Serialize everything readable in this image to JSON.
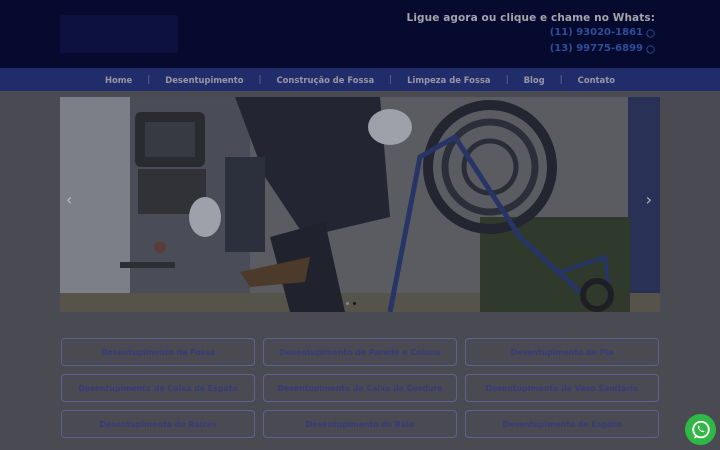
{
  "header": {
    "cta_text": "Ligue agora ou clique e chame no Whats:",
    "phones": [
      "(11) 93020-1861",
      "(13) 99775-6899"
    ],
    "phone_icon": "whatsapp-icon"
  },
  "nav": {
    "items": [
      "Home",
      "Desentupimento",
      "Construção de Fossa",
      "Limpeza de Fossa",
      "Blog",
      "Contato"
    ]
  },
  "hero": {
    "prev_glyph": "‹",
    "next_glyph": "›",
    "slide_count": 2,
    "active_slide": 2
  },
  "services": [
    "Desentupimento de Fossa",
    "Desentupimento de Parede e Coluna",
    "Desentupimento de Pia",
    "Desentupimento de Caixa de Esgoto",
    "Desentupimento de Caixa de Gordura",
    "Desentupimento de Vaso Sanitário",
    "Desentupimento de Raízes",
    "Desentupimento de Ralo",
    "Desentupimento de Esgoto"
  ],
  "colors": {
    "header_bg": "#060a2e",
    "nav_bg": "#212d6a",
    "overlay_bg": "#4a4a53",
    "whatsapp_green": "#2fb845"
  },
  "floating": {
    "icon": "whatsapp-icon"
  }
}
